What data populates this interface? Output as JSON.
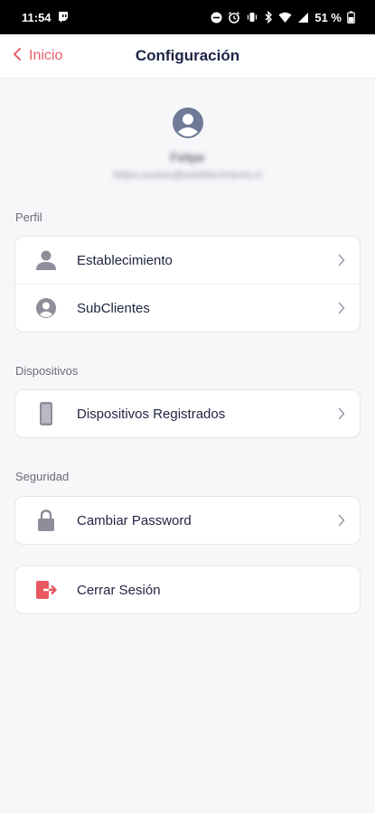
{
  "status_bar": {
    "time": "11:54",
    "battery": "51 %",
    "icons": [
      "twitch-icon",
      "do-not-disturb-icon",
      "alarm-icon",
      "vibrate-icon",
      "bluetooth-icon",
      "wifi-icon",
      "signal-icon",
      "battery-icon"
    ]
  },
  "nav": {
    "back_label": "Inicio",
    "title": "Configuración"
  },
  "profile": {
    "name": "Felipe",
    "email": "felipe.usuario@establecimiento.cl"
  },
  "sections": {
    "perfil": {
      "label": "Perfil",
      "items": [
        {
          "label": "Establecimiento",
          "icon": "person-icon"
        },
        {
          "label": "SubClientes",
          "icon": "account-circle-icon"
        }
      ]
    },
    "dispositivos": {
      "label": "Dispositivos",
      "items": [
        {
          "label": "Dispositivos Registrados",
          "icon": "phone-icon"
        }
      ]
    },
    "seguridad": {
      "label": "Seguridad",
      "items": [
        {
          "label": "Cambiar Password",
          "icon": "lock-icon"
        }
      ]
    },
    "logout": {
      "label": "Cerrar Sesión",
      "icon": "logout-icon"
    }
  },
  "colors": {
    "accent": "#e85d6a",
    "title": "#1e2347",
    "icon_gray": "#8e8e9a",
    "avatar": "#6f7b96",
    "background": "#f7f7fa"
  }
}
